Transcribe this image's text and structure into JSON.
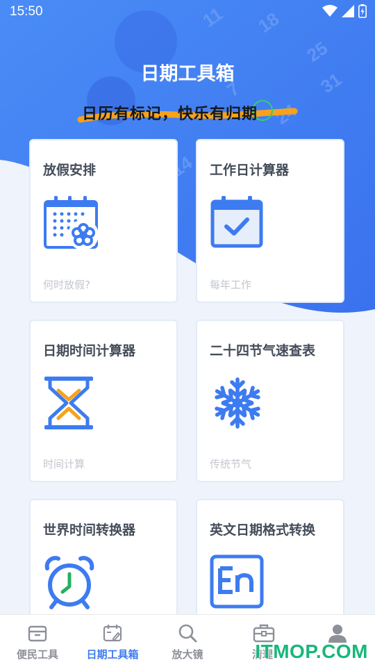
{
  "status_bar": {
    "time": "15:50"
  },
  "header": {
    "title": "日期工具箱",
    "slogan": "日历有标记，快乐有归期"
  },
  "cards": [
    {
      "title": "放假安排",
      "subtitle": "何时放假?",
      "icon": "holiday-calendar-icon"
    },
    {
      "title": "工作日计算器",
      "subtitle": "每年工作",
      "icon": "calendar-check-icon"
    },
    {
      "title": "日期时间计算器",
      "subtitle": "时间计算",
      "icon": "hourglass-icon"
    },
    {
      "title": "二十四节气速查表",
      "subtitle": "传统节气",
      "icon": "snowflake-icon"
    },
    {
      "title": "世界时间转换器",
      "subtitle": "",
      "icon": "alarm-clock-icon"
    },
    {
      "title": "英文日期格式转换",
      "subtitle": "",
      "icon": "en-letters-icon"
    }
  ],
  "bottom_nav": [
    {
      "label": "便民工具",
      "icon": "toolbox-icon",
      "active": false
    },
    {
      "label": "日期工具箱",
      "icon": "calendar-edit-icon",
      "active": true
    },
    {
      "label": "放大镜",
      "icon": "search-icon",
      "active": false
    },
    {
      "label": "清理",
      "icon": "briefcase-icon",
      "active": false
    },
    {
      "label": "",
      "icon": "person-icon",
      "active": false
    }
  ],
  "watermark": "ITMOP.COM",
  "colors": {
    "brand_blue": "#3d7bf0",
    "accent_orange": "#f7a21b",
    "text_dark": "#444c5a"
  }
}
